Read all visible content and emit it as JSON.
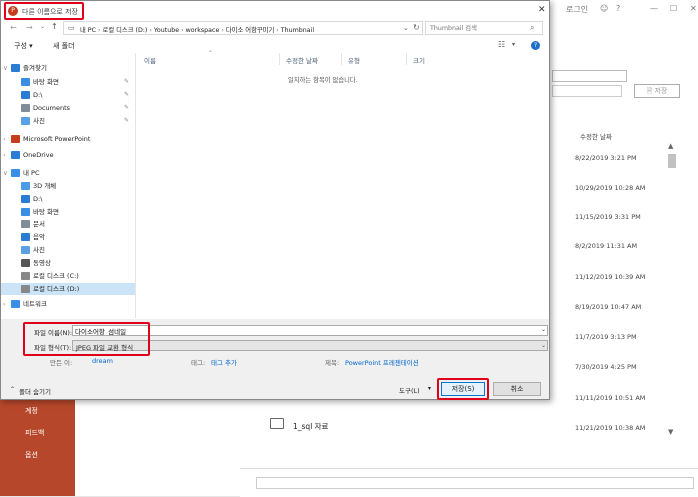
{
  "background": {
    "topbar": {
      "login_label": "로그인"
    },
    "search_placeholder": "",
    "save_btn_label": "저장",
    "column_modified": "수정한 날짜",
    "dates": [
      "8/22/2019 3:21 PM",
      "10/29/2019 10:28 AM",
      "11/15/2019 3:31 PM",
      "8/2/2019 11:31 AM",
      "11/12/2019 10:39 AM",
      "8/19/2019 10:47 AM",
      "11/7/2019 3:13 PM",
      "7/30/2019 4:25 PM",
      "11/11/2019 10:51 AM",
      "11/21/2019 10:38 AM"
    ],
    "folder_name": "1_sql 자료",
    "sidebar": [
      "계정",
      "피드백",
      "옵션"
    ]
  },
  "dialog": {
    "title": "다른 이름으로 저장",
    "breadcrumb": [
      "내 PC",
      "로컬 디스크 (D:)",
      "Youtube",
      "workspace",
      "다이소 어항꾸미기",
      "Thumbnail"
    ],
    "search_placeholder": "Thumbnail 검색",
    "toolbar": {
      "organize": "구성 ▾",
      "new_folder": "새 폴더"
    },
    "tree": [
      {
        "label": "즐겨찾기",
        "icon": "star-icon",
        "color": "#2b7cd3"
      },
      {
        "label": "바탕 화면",
        "icon": "desktop-icon",
        "color": "#3a8ee6",
        "pinned": true
      },
      {
        "label": "D:\\",
        "icon": "download-icon",
        "color": "#2b7cd3",
        "pinned": true
      },
      {
        "label": "Documents",
        "icon": "document-icon",
        "color": "#7f8c9a",
        "pinned": true
      },
      {
        "label": "사진",
        "icon": "picture-icon",
        "color": "#5aa0e6",
        "pinned": true
      },
      {
        "label": "Microsoft PowerPoint",
        "icon": "powerpoint-icon",
        "color": "#c43e1c"
      },
      {
        "label": "OneDrive",
        "icon": "cloud-icon",
        "color": "#2b7cd3"
      },
      {
        "label": "내 PC",
        "icon": "pc-icon",
        "color": "#3a8ee6"
      },
      {
        "label": "3D 개체",
        "icon": "cube-icon",
        "color": "#4a9be8"
      },
      {
        "label": "D:\\",
        "icon": "download-icon",
        "color": "#2b7cd3"
      },
      {
        "label": "바탕 화면",
        "icon": "desktop-icon",
        "color": "#3a8ee6"
      },
      {
        "label": "문서",
        "icon": "document-icon",
        "color": "#7f8c9a"
      },
      {
        "label": "음악",
        "icon": "music-icon",
        "color": "#2b7cd3"
      },
      {
        "label": "사진",
        "icon": "picture-icon",
        "color": "#5aa0e6"
      },
      {
        "label": "동영상",
        "icon": "video-icon",
        "color": "#555"
      },
      {
        "label": "로컬 디스크 (C:)",
        "icon": "disk-icon",
        "color": "#888"
      },
      {
        "label": "로컬 디스크 (D:)",
        "icon": "disk-icon",
        "color": "#888"
      },
      {
        "label": "네트워크",
        "icon": "network-icon",
        "color": "#3a8ee6"
      }
    ],
    "columns": [
      "이름",
      "수정한 날짜",
      "유형",
      "크기"
    ],
    "empty_message": "일치하는 항목이 없습니다.",
    "filename_label": "파일 이름(N):",
    "filename_value": "다이소어항_섬네일",
    "filetype_label": "파일 형식(T):",
    "filetype_value": "JPEG 파일 교환 형식",
    "author_label": "만든 이:",
    "author_value": "dream",
    "tags_label": "태그:",
    "tags_value": "태그 추가",
    "title_label": "제목:",
    "title_value": "PowerPoint 프레젠테이션",
    "hide_folders": "폴더 숨기기",
    "tools": "도구(L)",
    "save": "저장(S)",
    "cancel": "취소"
  }
}
